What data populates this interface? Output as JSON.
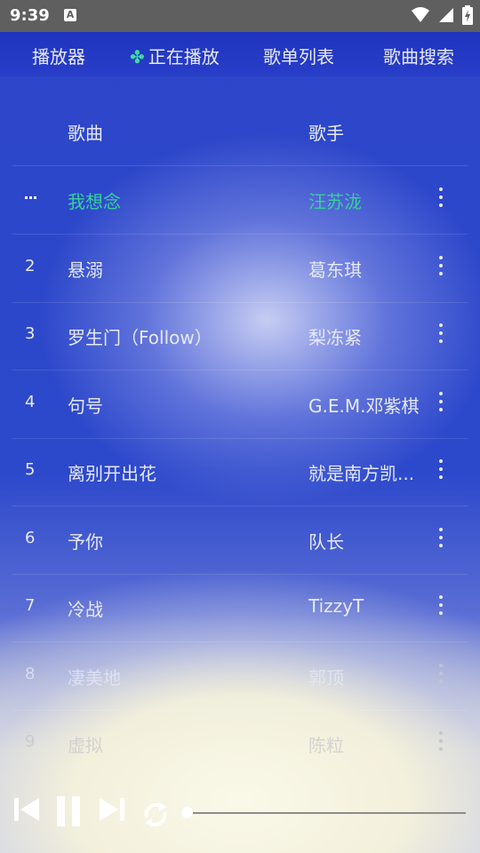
{
  "status": {
    "time": "9:39",
    "badge": "A"
  },
  "tabs": [
    {
      "label": "播放器"
    },
    {
      "label": "正在播放",
      "icon": "clover-icon",
      "active": true
    },
    {
      "label": "歌单列表"
    },
    {
      "label": "歌曲搜索"
    }
  ],
  "table": {
    "headers": {
      "song": "歌曲",
      "artist": "歌手"
    },
    "rows": [
      {
        "num": "...",
        "title": "我想念",
        "artist": "汪苏泷",
        "playing": true
      },
      {
        "num": "2",
        "title": "悬溺",
        "artist": "葛东琪"
      },
      {
        "num": "3",
        "title": "罗生门（Follow）",
        "artist": "梨冻紧"
      },
      {
        "num": "4",
        "title": "句号",
        "artist": "G.E.M.邓紫棋"
      },
      {
        "num": "5",
        "title": "离别开出花",
        "artist": "就是南方凯..."
      },
      {
        "num": "6",
        "title": "予你",
        "artist": "队长"
      },
      {
        "num": "7",
        "title": "冷战",
        "artist": "TizzyT"
      },
      {
        "num": "8",
        "title": "凄美地",
        "artist": "郭顶"
      },
      {
        "num": "9",
        "title": "虚拟",
        "artist": "陈粒"
      }
    ]
  },
  "player": {
    "progress": 0.0,
    "colors": {
      "accent": "#37d29a",
      "bg": "#2c48cb"
    }
  }
}
